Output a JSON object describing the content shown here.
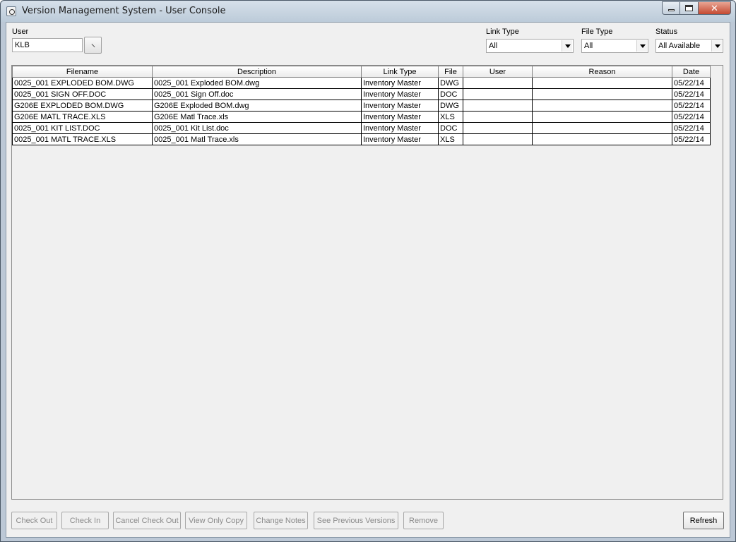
{
  "window": {
    "title": "Version Management System - User Console"
  },
  "filters": {
    "user_label": "User",
    "user_value": "KLB",
    "link_type_label": "Link Type",
    "link_type_value": "All",
    "file_type_label": "File Type",
    "file_type_value": "All",
    "status_label": "Status",
    "status_value": "All Available"
  },
  "table": {
    "columns": [
      "Filename",
      "Description",
      "Link Type",
      "File",
      "User",
      "Reason",
      "Date"
    ],
    "rows": [
      [
        "0025_001 EXPLODED BOM.DWG",
        "0025_001 Exploded BOM.dwg",
        "Inventory Master",
        "DWG",
        "",
        "",
        "05/22/14"
      ],
      [
        "0025_001 SIGN OFF.DOC",
        "0025_001 Sign Off.doc",
        "Inventory Master",
        "DOC",
        "",
        "",
        "05/22/14"
      ],
      [
        "G206E EXPLODED BOM.DWG",
        "G206E Exploded BOM.dwg",
        "Inventory Master",
        "DWG",
        "",
        "",
        "05/22/14"
      ],
      [
        "G206E MATL TRACE.XLS",
        "G206E Matl Trace.xls",
        "Inventory Master",
        "XLS",
        "",
        "",
        "05/22/14"
      ],
      [
        "0025_001 KIT LIST.DOC",
        "0025_001 Kit List.doc",
        "Inventory Master",
        "DOC",
        "",
        "",
        "05/22/14"
      ],
      [
        "0025_001 MATL TRACE.XLS",
        "0025_001 Matl Trace.xls",
        "Inventory Master",
        "XLS",
        "",
        "",
        "05/22/14"
      ]
    ]
  },
  "buttons": {
    "check_out": "Check Out",
    "check_in": "Check In",
    "cancel_check_out": "Cancel Check Out",
    "view_only_copy": "View Only Copy",
    "change_notes": "Change Notes",
    "see_previous_versions": "See Previous Versions",
    "remove": "Remove",
    "refresh": "Refresh"
  }
}
